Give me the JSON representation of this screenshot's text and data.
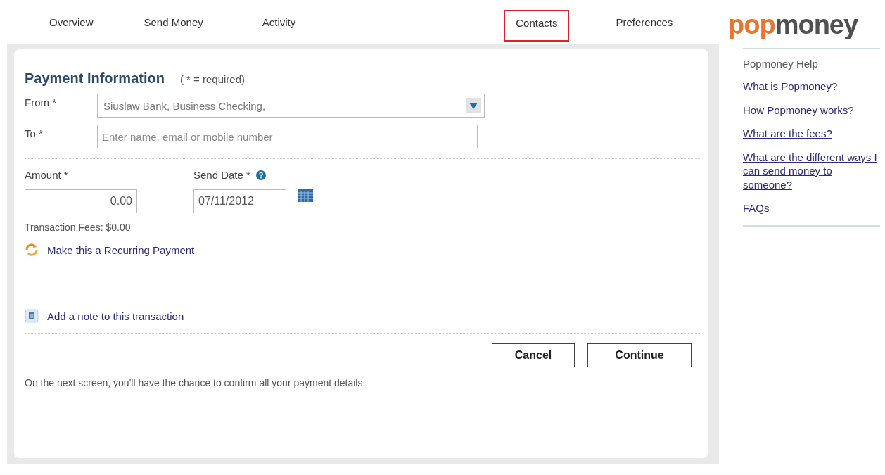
{
  "tabs": [
    {
      "label": "Overview",
      "highlighted": false
    },
    {
      "label": "Send Money",
      "highlighted": false
    },
    {
      "label": "Activity",
      "highlighted": false
    },
    {
      "label": "Contacts",
      "highlighted": true
    },
    {
      "label": "Preferences",
      "highlighted": false
    }
  ],
  "logo": {
    "first": "pop",
    "second": "money"
  },
  "form": {
    "title": "Payment Information",
    "required_note": "( * = required)",
    "from": {
      "label": "From *",
      "value": "Siuslaw Bank, Business Checking,"
    },
    "to": {
      "label": "To *",
      "placeholder": "Enter name, email or mobile number"
    },
    "amount": {
      "label": "Amount *",
      "value": "0.00"
    },
    "send_date": {
      "label": "Send Date *",
      "value": "07/11/2012"
    },
    "fees": "Transaction Fees: $0.00",
    "recurring_link": "Make this a Recurring Payment",
    "note_link": "Add a note to this transaction",
    "buttons": [
      "Cancel",
      "Continue"
    ],
    "footer": "On the next screen, you'll have the chance to confirm all your payment details."
  },
  "help": {
    "title": "Popmoney Help",
    "links": [
      "What is Popmoney?",
      "How Popmoney works?",
      "What are the fees?",
      "What are the different ways I can send money to someone?",
      "FAQs"
    ]
  }
}
